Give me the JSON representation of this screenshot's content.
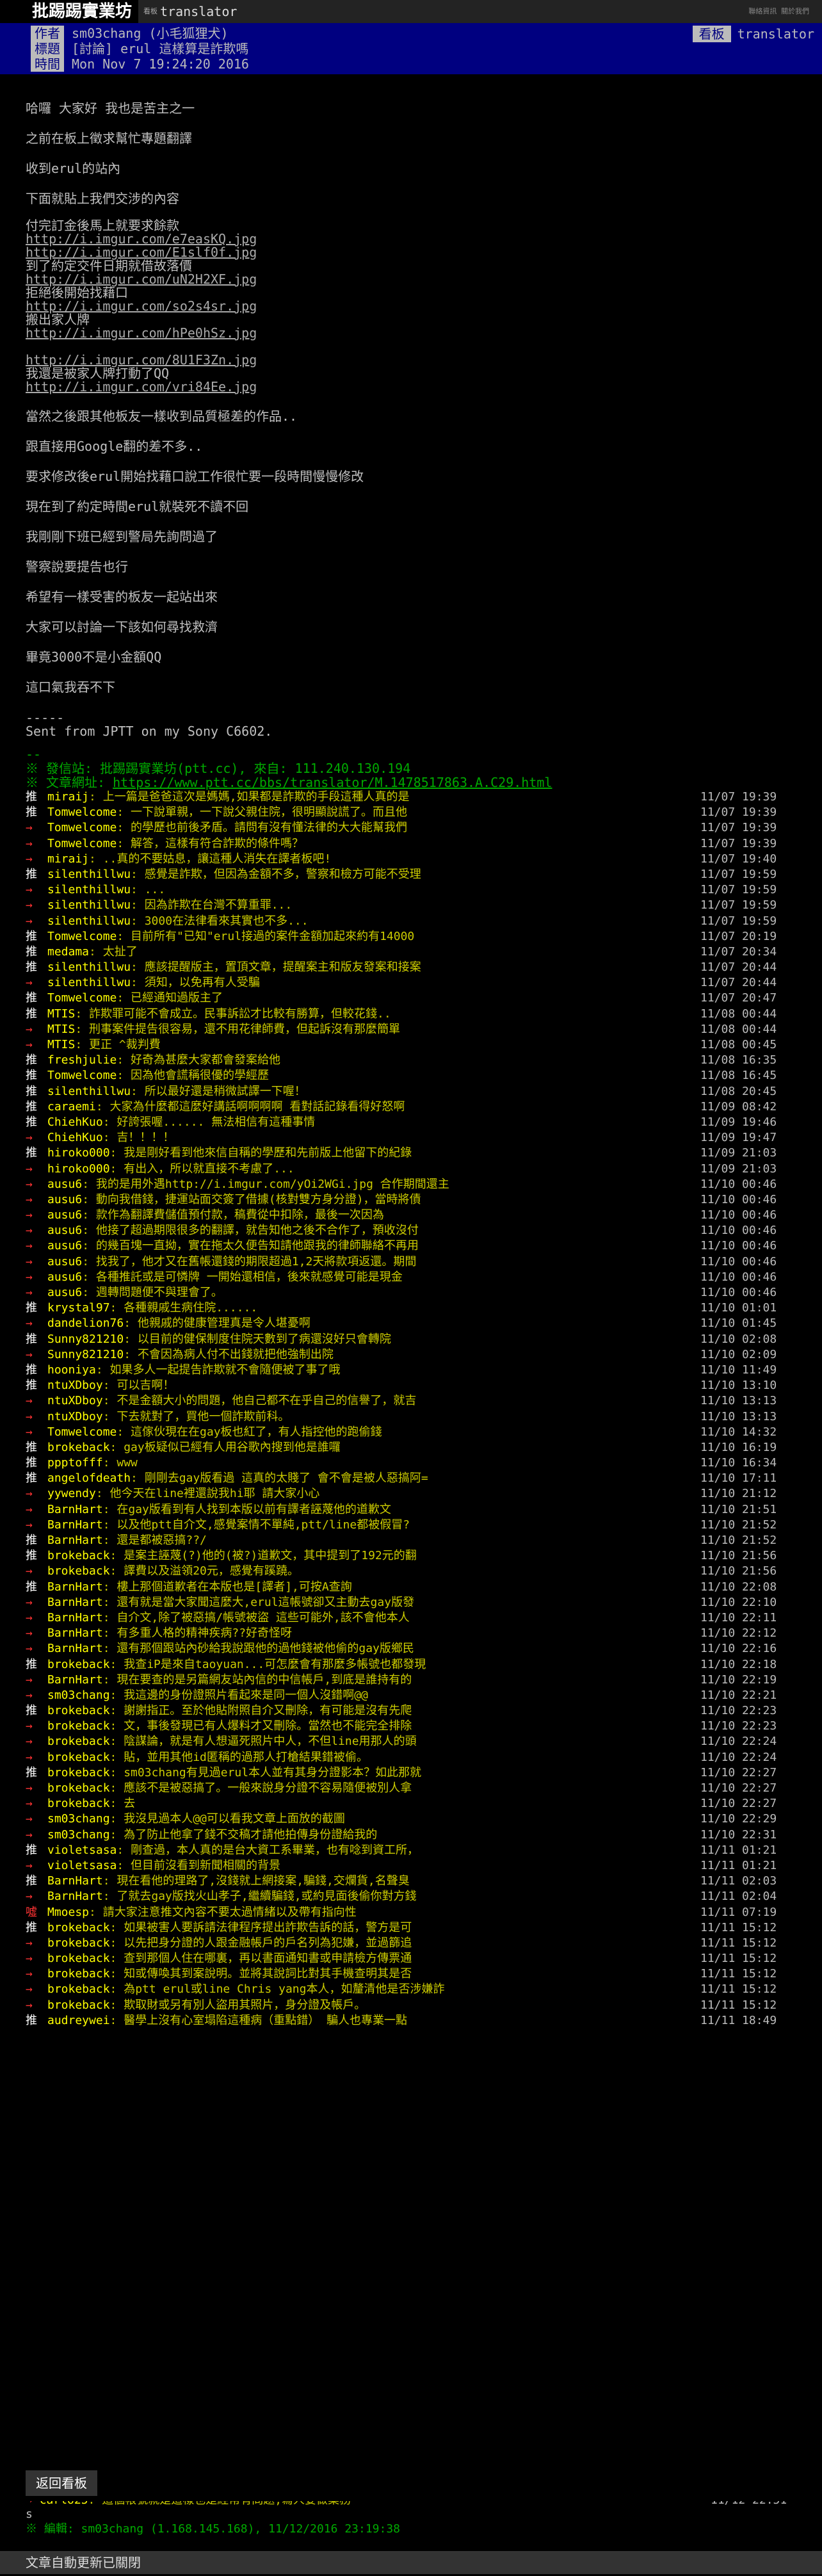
{
  "topbar": {
    "board_button": "批踢踢實業坊",
    "caption": "看板",
    "board_name": "translator",
    "right_links": "聯絡資訊  關於我們"
  },
  "header": {
    "author_label": "作者",
    "author": "sm03chang (小毛狐狸犬)",
    "title_label": "標題",
    "title": "[討論] erul 這樣算是詐欺嗎",
    "time_label": "時間",
    "time": "Mon Nov  7 19:24:20 2016",
    "board_label": "看板",
    "board": "translator"
  },
  "body": {
    "paras1": [
      "哈囉 大家好 我也是苦主之一",
      "之前在板上徵求幫忙專題翻譯",
      "收到erul的站內",
      "下面就貼上我們交涉的內容"
    ],
    "block": [
      {
        "t": "text",
        "v": "付完訂金後馬上就要求餘款"
      },
      {
        "t": "url",
        "v": "http://i.imgur.com/e7easKQ.jpg"
      },
      {
        "t": "url",
        "v": "http://i.imgur.com/E1slf0f.jpg"
      },
      {
        "t": "text",
        "v": "到了約定交件日期就借故落價"
      },
      {
        "t": "url",
        "v": "http://i.imgur.com/uN2H2XF.jpg"
      },
      {
        "t": "text",
        "v": "拒絕後開始找藉口"
      },
      {
        "t": "url",
        "v": "http://i.imgur.com/so2s4sr.jpg"
      },
      {
        "t": "text",
        "v": "搬出家人牌"
      },
      {
        "t": "url",
        "v": "http://i.imgur.com/hPe0hSz.jpg"
      },
      {
        "t": "gap",
        "v": ""
      },
      {
        "t": "url",
        "v": "http://i.imgur.com/8U1F3Zn.jpg"
      },
      {
        "t": "text",
        "v": "我還是被家人牌打動了QQ"
      },
      {
        "t": "url",
        "v": "http://i.imgur.com/vri84Ee.jpg"
      }
    ],
    "paras2": [
      "當然之後跟其他板友一樣收到品質極差的作品..",
      "跟直接用Google翻的差不多..",
      "要求修改後erul開始找藉口說工作很忙要一段時間慢慢修改",
      "現在到了約定時間erul就裝死不讀不回",
      "我剛剛下班已經到警局先詢問過了",
      "警察說要提告也行",
      "希望有一樣受害的板友一起站出來",
      "大家可以討論一下該如何尋找救濟",
      "畢竟3000不是小金額QQ",
      "這口氣我吞不下"
    ],
    "sig": [
      "-----",
      "Sent from JPTT on my Sony C6602."
    ],
    "dashes": "--",
    "from_line": "※ 發信站: 批踢踢實業坊(ptt.cc), 來自: 111.240.130.194",
    "url_label": "※ 文章網址: ",
    "article_url": "https://www.ptt.cc/bbs/translator/M.1478517863.A.C29.html"
  },
  "pushes": [
    {
      "tag": "推",
      "user": "miraij",
      "content": ": 上一篇是爸爸這次是媽媽,如果都是詐欺的手段這種人真的是",
      "time": "11/07 19:39"
    },
    {
      "tag": "推",
      "user": "Tomwelcome",
      "content": ": 一下說單親，一下說父親住院，很明顯說謊了。而且他",
      "time": "11/07 19:39"
    },
    {
      "tag": "→",
      "user": "Tomwelcome",
      "content": ": 的學歷也前後矛盾。請問有沒有懂法律的大大能幫我們",
      "time": "11/07 19:39"
    },
    {
      "tag": "→",
      "user": "Tomwelcome",
      "content": ": 解答，這樣有符合詐欺的條件嗎？",
      "time": "11/07 19:39"
    },
    {
      "tag": "→",
      "user": "miraij",
      "content": ": ..真的不要姑息，讓這種人消失在譯者板吧!",
      "time": "11/07 19:40"
    },
    {
      "tag": "推",
      "user": "silenthillwu",
      "content": ": 感覺是詐欺，但因為金額不多，警察和檢方可能不受理",
      "time": "11/07 19:59"
    },
    {
      "tag": "→",
      "user": "silenthillwu",
      "content": ": ...",
      "time": "11/07 19:59"
    },
    {
      "tag": "→",
      "user": "silenthillwu",
      "content": ": 因為詐欺在台灣不算重罪...",
      "time": "11/07 19:59"
    },
    {
      "tag": "→",
      "user": "silenthillwu",
      "content": ": 3000在法律看來其實也不多...",
      "time": "11/07 19:59"
    },
    {
      "tag": "推",
      "user": "Tomwelcome",
      "content": ": 目前所有\"已知\"erul接過的案件金額加起來約有14000",
      "time": "11/07 20:19"
    },
    {
      "tag": "推",
      "user": "medama",
      "content": ": 太扯了",
      "time": "11/07 20:34"
    },
    {
      "tag": "推",
      "user": "silenthillwu",
      "content": ": 應該提醒版主，置頂文章，提醒案主和版友發案和接案",
      "time": "11/07 20:44"
    },
    {
      "tag": "→",
      "user": "silenthillwu",
      "content": ": 須知，以免再有人受騙",
      "time": "11/07 20:44"
    },
    {
      "tag": "推",
      "user": "Tomwelcome",
      "content": ": 已經通知過版主了",
      "time": "11/07 20:47"
    },
    {
      "tag": "推",
      "user": "MTIS",
      "content": ": 詐欺罪可能不會成立。民事訴訟才比較有勝算，但較花錢..",
      "time": "11/08 00:44"
    },
    {
      "tag": "→",
      "user": "MTIS",
      "content": ": 刑事案件提告很容易，還不用花律師費，但起訴沒有那麼簡單",
      "time": "11/08 00:44"
    },
    {
      "tag": "→",
      "user": "MTIS",
      "content": ": 更正   ^裁判費",
      "time": "11/08 00:45"
    },
    {
      "tag": "推",
      "user": "freshjulie",
      "content": ": 好奇為甚麼大家都會發案給他",
      "time": "11/08 16:35"
    },
    {
      "tag": "推",
      "user": "Tomwelcome",
      "content": ": 因為他會謊稱很優的學經歷",
      "time": "11/08 16:45"
    },
    {
      "tag": "推",
      "user": "silenthillwu",
      "content": ": 所以最好還是稍微試譯一下喔！",
      "time": "11/08 20:45"
    },
    {
      "tag": "推",
      "user": "caraemi",
      "content": ": 大家為什麼都這麼好講話啊啊啊啊 看對話記錄看得好怒啊",
      "time": "11/09 08:42"
    },
    {
      "tag": "推",
      "user": "ChiehKuo",
      "content": ": 好誇張喔...... 無法相信有這種事情",
      "time": "11/09 19:46"
    },
    {
      "tag": "→",
      "user": "ChiehKuo",
      "content": ": 吉！！！！",
      "time": "11/09 19:47"
    },
    {
      "tag": "推",
      "user": "hiroko000",
      "content": ": 我是剛好看到他來信自稱的學歷和先前版上他留下的紀錄",
      "time": "11/09 21:03"
    },
    {
      "tag": "→",
      "user": "hiroko000",
      "content": ": 有出入，所以就直接不考慮了...",
      "time": "11/09 21:03"
    },
    {
      "tag": "→",
      "user": "ausu6",
      "content": ": 我的是用外遇http://i.imgur.com/yOi2WGi.jpg 合作期間還主",
      "time": "11/10 00:46"
    },
    {
      "tag": "→",
      "user": "ausu6",
      "content": ": 動向我借錢，捷運站面交簽了借據(核對雙方身分證)，當時將債",
      "time": "11/10 00:46"
    },
    {
      "tag": "→",
      "user": "ausu6",
      "content": ": 款作為翻譯費儲值預付款，稿費從中扣除，最後一次因為",
      "time": "11/10 00:46"
    },
    {
      "tag": "→",
      "user": "ausu6",
      "content": ": 他接了超過期限很多的翻譯，就告知他之後不合作了，預收沒付",
      "time": "11/10 00:46"
    },
    {
      "tag": "→",
      "user": "ausu6",
      "content": ": 的幾百塊一直拗，實在拖太久便告知請他跟我的律師聯絡不再用",
      "time": "11/10 00:46"
    },
    {
      "tag": "→",
      "user": "ausu6",
      "content": ": 找我了，他才又在舊帳還錢的期限超過1,2天將款項返還。期間",
      "time": "11/10 00:46"
    },
    {
      "tag": "→",
      "user": "ausu6",
      "content": ": 各種推託或是可憐牌  一開始還相信，後來就感覺可能是現金",
      "time": "11/10 00:46"
    },
    {
      "tag": "→",
      "user": "ausu6",
      "content": ": 週轉問題便不與理會了。",
      "time": "11/10 00:46"
    },
    {
      "tag": "推",
      "user": "krystal97",
      "content": ": 各種親戚生病住院......",
      "time": "11/10 01:01"
    },
    {
      "tag": "→",
      "user": "dandelion76",
      "content": ": 他親戚的健康管理真是令人堪憂啊",
      "time": "11/10 01:45"
    },
    {
      "tag": "推",
      "user": "Sunny821210",
      "content": ": 以目前的健保制度住院天數到了病還沒好只會轉院",
      "time": "11/10 02:08"
    },
    {
      "tag": "→",
      "user": "Sunny821210",
      "content": ": 不會因為病人付不出錢就把他強制出院",
      "time": "11/10 02:09"
    },
    {
      "tag": "推",
      "user": "hooniya",
      "content": ": 如果多人一起提告詐欺就不會隨便被了事了哦",
      "time": "11/10 11:49"
    },
    {
      "tag": "推",
      "user": "ntuXDboy",
      "content": ": 可以吉啊！",
      "time": "11/10 13:10"
    },
    {
      "tag": "→",
      "user": "ntuXDboy",
      "content": ": 不是金額大小的問題，他自己都不在乎自己的信譽了，就吉",
      "time": "11/10 13:13"
    },
    {
      "tag": "→",
      "user": "ntuXDboy",
      "content": ": 下去就對了，買他一個詐欺前科。",
      "time": "11/10 13:13"
    },
    {
      "tag": "→",
      "user": "Tomwelcome",
      "content": ": 這傢伙現在在gay板也紅了，有人指控他的跑偷錢",
      "time": "11/10 14:32"
    },
    {
      "tag": "推",
      "user": "brokeback",
      "content": ": gay板疑似已經有人用谷歌內搜到他是誰囉",
      "time": "11/10 16:19"
    },
    {
      "tag": "推",
      "user": "ppptofff",
      "content": ": www",
      "time": "11/10 16:34"
    },
    {
      "tag": "推",
      "user": "angelofdeath",
      "content": ": 剛剛去gay版看過 這真的太賤了 會不會是被人惡搞阿=",
      "time": "11/10 17:11"
    },
    {
      "tag": "→",
      "user": "yywendy",
      "content": ": 他今天在line裡還說我hi耶  請大家小心",
      "time": "11/10 21:12"
    },
    {
      "tag": "→",
      "user": "BarnHart",
      "content": ": 在gay版看到有人找到本版以前有譯者誣蔑他的道歉文",
      "time": "11/10 21:51"
    },
    {
      "tag": "→",
      "user": "BarnHart",
      "content": ": 以及他ptt自介文,感覺案情不單純,ptt/line都被假冒?",
      "time": "11/10 21:52"
    },
    {
      "tag": "推",
      "user": "BarnHart",
      "content": ": 還是都被惡搞??/",
      "time": "11/10 21:52"
    },
    {
      "tag": "推",
      "user": "brokeback",
      "content": ": 是案主誣蔑(?)他的(被?)道歉文，其中提到了192元的翻",
      "time": "11/10 21:56"
    },
    {
      "tag": "→",
      "user": "brokeback",
      "content": ": 譯費以及溢領20元，感覺有蹊蹺。",
      "time": "11/10 21:56"
    },
    {
      "tag": "推",
      "user": "BarnHart",
      "content": ": 樓上那個道歉者在本版也是[譯者],可按A查詢",
      "time": "11/10 22:08"
    },
    {
      "tag": "→",
      "user": "BarnHart",
      "content": ": 還有就是當大家聞這麼大,erul這帳號卻又主動去gay版發",
      "time": "11/10 22:10"
    },
    {
      "tag": "→",
      "user": "BarnHart",
      "content": ": 自介文,除了被惡搞/帳號被盜 這些可能外,該不會他本人",
      "time": "11/10 22:11"
    },
    {
      "tag": "→",
      "user": "BarnHart",
      "content": ": 有多重人格的精神疾病??好奇怪呀",
      "time": "11/10 22:12"
    },
    {
      "tag": "→",
      "user": "BarnHart",
      "content": ": 還有那個跟站內砂給我說跟他的過他錢被他偷的gay版鄉民",
      "time": "11/10 22:16"
    },
    {
      "tag": "推",
      "user": "brokeback",
      "content": ": 我查iP是來自taoyuan...可怎麼會有那麼多帳號也都發現",
      "time": "11/10 22:18"
    },
    {
      "tag": "→",
      "user": "BarnHart",
      "content": ": 現在要查的是另篇網友站內信的中信帳戶,到底是誰持有的",
      "time": "11/10 22:19"
    },
    {
      "tag": "→",
      "user": "sm03chang",
      "content": ": 我這邊的身份證照片看起來是同一個人沒錯啊@@",
      "time": "11/10 22:21"
    },
    {
      "tag": "推",
      "user": "brokeback",
      "content": ": 謝謝指正。至於他貼附照自介又刪除，有可能是沒有先爬",
      "time": "11/10 22:23"
    },
    {
      "tag": "→",
      "user": "brokeback",
      "content": ": 文，事後發現已有人爆料才又刪除。當然也不能完全排除",
      "time": "11/10 22:23"
    },
    {
      "tag": "→",
      "user": "brokeback",
      "content": ": 陰謀論，就是有人想逼死照片中人，不但line用那人的頭",
      "time": "11/10 22:24"
    },
    {
      "tag": "→",
      "user": "brokeback",
      "content": ": 貼，並用其他id匿稱的過那人打槍結果錯被偷。",
      "time": "11/10 22:24"
    },
    {
      "tag": "推",
      "user": "brokeback",
      "content": ": sm03chang有見過erul本人並有其身分證影本？如此那就",
      "time": "11/10 22:27"
    },
    {
      "tag": "→",
      "user": "brokeback",
      "content": ": 應該不是被惡搞了。一般來說身分證不容易隨便被別人拿",
      "time": "11/10 22:27"
    },
    {
      "tag": "→",
      "user": "brokeback",
      "content": ": 去",
      "time": "11/10 22:27"
    },
    {
      "tag": "→",
      "user": "sm03chang",
      "content": ": 我沒見過本人@@可以看我文章上面放的截圖",
      "time": "11/10 22:29"
    },
    {
      "tag": "→",
      "user": "sm03chang",
      "content": ": 為了防止他拿了錢不交稿才請他拍傳身份證給我的",
      "time": "11/10 22:31"
    },
    {
      "tag": "推",
      "user": "violetsasa",
      "content": ": 剛查過，本人真的是台大資工系畢業，也有唸到資工所，",
      "time": "11/11 01:21"
    },
    {
      "tag": "→",
      "user": "violetsasa",
      "content": ": 但目前沒看到新聞相關的背景",
      "time": "11/11 01:21"
    },
    {
      "tag": "推",
      "user": "BarnHart",
      "content": ": 現在看他的理路了,沒錢就上網接案,騙錢,交爛貨,名聲臭",
      "time": "11/11 02:03"
    },
    {
      "tag": "→",
      "user": "BarnHart",
      "content": ": 了就去gay版找火山孝子,繼續騙錢,或約見面後偷你對方錢",
      "time": "11/11 02:04"
    },
    {
      "tag": "噓",
      "user": "Mmoesp",
      "content": ": 請大家注意推文內容不要太過情緒以及帶有指向性",
      "time": "11/11 07:19"
    },
    {
      "tag": "推",
      "user": "brokeback",
      "content": ": 如果被害人要訴請法律程序提出詐欺告訴的話，警方是可",
      "time": "11/11 15:12"
    },
    {
      "tag": "→",
      "user": "brokeback",
      "content": ": 以先把身分證的人跟金融帳戶的戶名列為犯嫌，並過篩追",
      "time": "11/11 15:12"
    },
    {
      "tag": "→",
      "user": "brokeback",
      "content": ": 查到那個人住在哪裏，再以書面通知書或申請檢方傳票通",
      "time": "11/11 15:12"
    },
    {
      "tag": "→",
      "user": "brokeback",
      "content": ": 知或傳喚其到案說明。並將其說詞比對其手機查明其是否",
      "time": "11/11 15:12"
    },
    {
      "tag": "→",
      "user": "brokeback",
      "content": ": 為ptt erul或line Chris yang本人，如釐清他是否涉嫌詐",
      "time": "11/11 15:12"
    },
    {
      "tag": "→",
      "user": "brokeback",
      "content": ": 欺取財或另有別人盜用其照片，身分證及帳戶。",
      "time": "11/11 15:12"
    },
    {
      "tag": "推",
      "user": "audreywei",
      "content": ": 醫學上沒有心室塌陷這種病（重點錯） 騙人也專業一點",
      "time": "11/11 18:49"
    }
  ],
  "last_push": {
    "tag": "→",
    "user": "carlo25",
    "content": ": 這個帳號就是這樣也是經常有問題,寫人要做業務",
    "time": "11/12 22:51"
  },
  "tail_s": "s",
  "edit_line": "※ 編輯: sm03chang (1.168.145.168), 11/12/2016 23:19:38",
  "back_button": "返回看板",
  "auto_update": "文章自動更新已關閉"
}
